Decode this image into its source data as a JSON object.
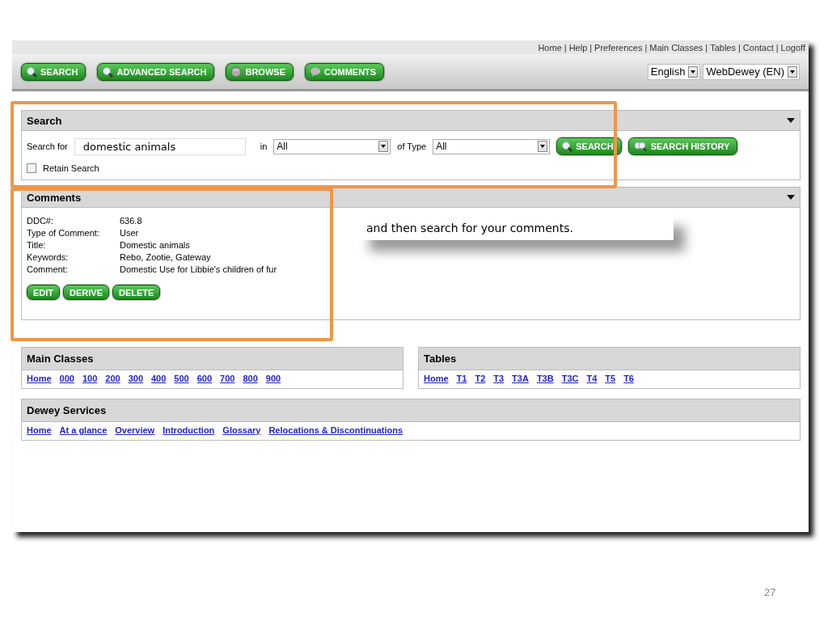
{
  "top_links": {
    "separator": "|",
    "items": [
      "Home",
      "Help",
      "Preferences",
      "Main Classes",
      "Tables",
      "Contact",
      "Logoff"
    ]
  },
  "toolbar": [
    {
      "label": "SEARCH",
      "kind": "search"
    },
    {
      "label": "ADVANCED SEARCH",
      "kind": "search"
    },
    {
      "label": "BROWSE",
      "kind": "browse"
    },
    {
      "label": "COMMENTS",
      "kind": "comments"
    }
  ],
  "language": {
    "value": "English"
  },
  "edition": {
    "value": "WebDewey (EN)"
  },
  "search_panel": {
    "title": "Search",
    "search_for_label": "Search for",
    "query": "domestic animals",
    "in_label": "in",
    "in_value": "All",
    "type_label": "of Type",
    "type_value": "All",
    "search_button": "SEARCH",
    "history_button": "SEARCH HISTORY",
    "retain": {
      "label": "Retain Search",
      "checked": false
    }
  },
  "comments_panel": {
    "title": "Comments",
    "fields": [
      {
        "label": "DDC#:",
        "value": "636.8"
      },
      {
        "label": "Type of Comment:",
        "value": "User"
      },
      {
        "label": "Title:",
        "value": "Domestic animals"
      },
      {
        "label": "Keywords:",
        "value": "Rebo, Zootie, Gateway"
      },
      {
        "label": "Comment:",
        "value": "Domestic Use for Libbie's children of fur"
      }
    ],
    "buttons": [
      "EDIT",
      "DERIVE",
      "DELETE"
    ]
  },
  "callout": "and then search for your comments.",
  "main_classes": {
    "title": "Main Classes",
    "links": [
      "Home",
      "000",
      "100",
      "200",
      "300",
      "400",
      "500",
      "600",
      "700",
      "800",
      "900"
    ]
  },
  "tables": {
    "title": "Tables",
    "links": [
      "Home",
      "T1",
      "T2",
      "T3",
      "T3A",
      "T3B",
      "T3C",
      "T4",
      "T5",
      "T6"
    ]
  },
  "dewey_services": {
    "title": "Dewey Services",
    "links": [
      "Home",
      "At a glance",
      "Overview",
      "Introduction",
      "Glossary",
      "Relocations & Discontinuations"
    ]
  },
  "slide_number": "27"
}
